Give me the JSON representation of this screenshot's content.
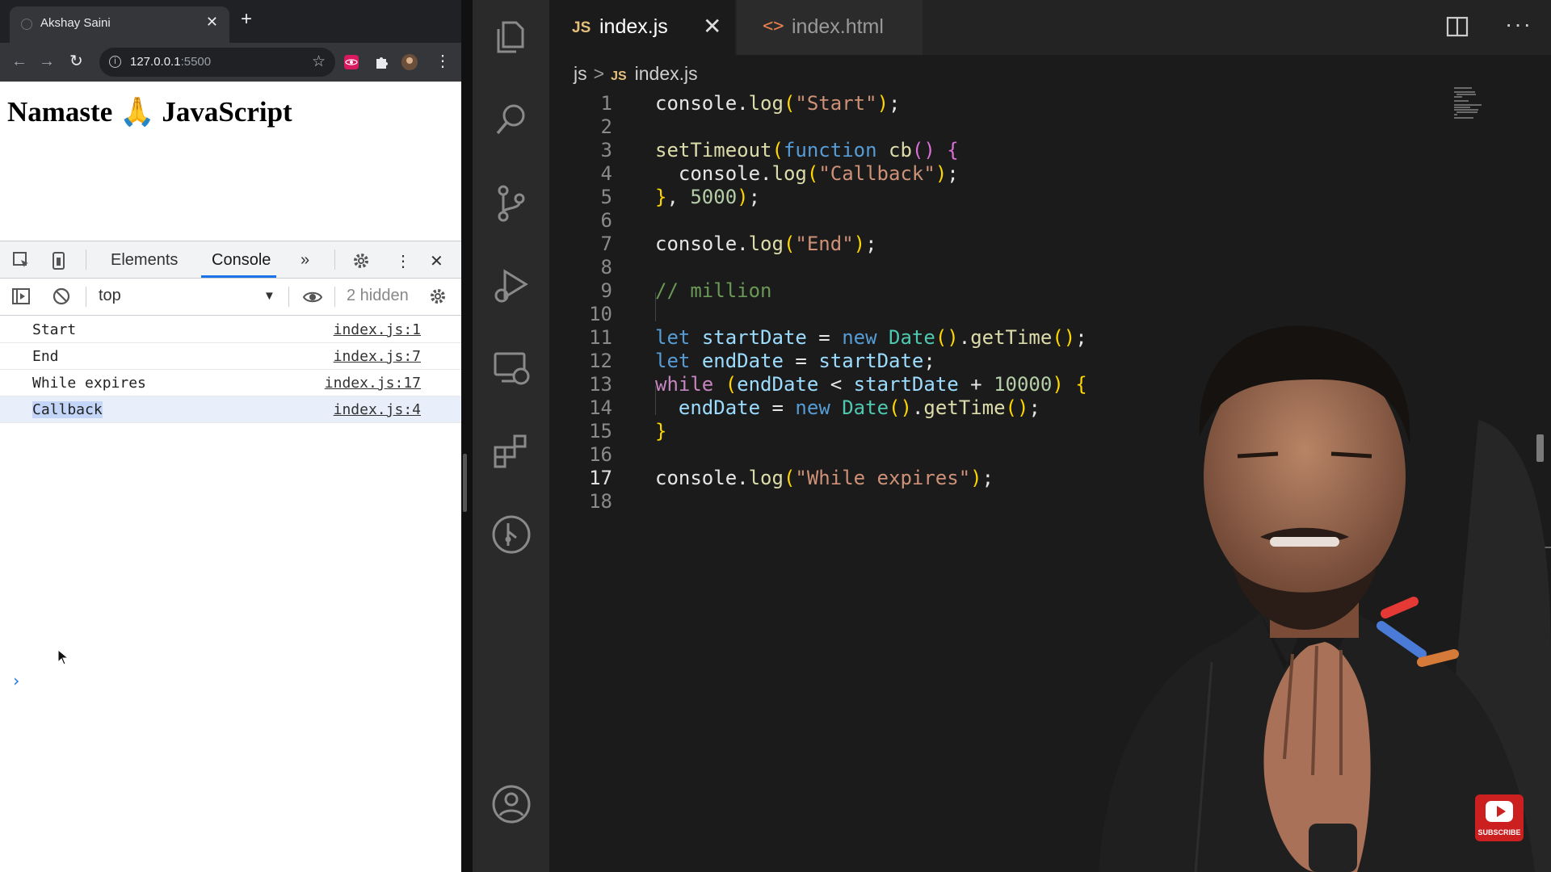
{
  "browser": {
    "tab_title": "Akshay Saini",
    "tab_close": "✕",
    "new_tab": "+",
    "url_host": "127.0.0.1",
    "url_port": ":5500",
    "page_heading": "Namaste 🙏 JavaScript"
  },
  "devtools": {
    "tabs": [
      "Elements",
      "Console"
    ],
    "more_tabs": "»",
    "context": "top",
    "hidden_count": "2 hidden",
    "close": "✕",
    "prompt": "›",
    "logs": [
      {
        "message": "Start",
        "source": "index.js:1"
      },
      {
        "message": "End",
        "source": "index.js:7"
      },
      {
        "message": "While expires",
        "source": "index.js:17"
      },
      {
        "message": "Callback",
        "source": "index.js:4"
      }
    ]
  },
  "editor": {
    "tabs": [
      {
        "badge": "JS",
        "label": "index.js",
        "active": true,
        "close": "✕"
      },
      {
        "badge": "<>",
        "label": "index.html",
        "active": false
      }
    ],
    "more_actions": "···",
    "breadcrumb": {
      "folder": "js",
      "separator": ">",
      "badge": "JS",
      "file": "index.js"
    },
    "current_line": "17",
    "lines": [
      {
        "n": "1",
        "text": "console.log(\"Start\");"
      },
      {
        "n": "2",
        "text": ""
      },
      {
        "n": "3",
        "text": "setTimeout(function cb() {"
      },
      {
        "n": "4",
        "text": "  console.log(\"Callback\");"
      },
      {
        "n": "5",
        "text": "}, 5000);"
      },
      {
        "n": "6",
        "text": ""
      },
      {
        "n": "7",
        "text": "console.log(\"End\");"
      },
      {
        "n": "8",
        "text": ""
      },
      {
        "n": "9",
        "text": "// million"
      },
      {
        "n": "10",
        "text": ""
      },
      {
        "n": "11",
        "text": "let startDate = new Date().getTime();"
      },
      {
        "n": "12",
        "text": "let endDate = startDate;"
      },
      {
        "n": "13",
        "text": "while (endDate < startDate + 10000) {"
      },
      {
        "n": "14",
        "text": "  endDate = new Date().getTime();"
      },
      {
        "n": "15",
        "text": "}"
      },
      {
        "n": "16",
        "text": ""
      },
      {
        "n": "17",
        "text": "console.log(\"While expires\");"
      },
      {
        "n": "18",
        "text": ""
      }
    ]
  },
  "overlay": {
    "subscribe_label": "SUBSCRIBE"
  },
  "colors": {
    "accent": "#1a73e8",
    "keyword": "#569cd6",
    "string": "#ce9178",
    "number": "#b5cea8",
    "comment": "#6a9955",
    "function": "#dcdcaa"
  }
}
